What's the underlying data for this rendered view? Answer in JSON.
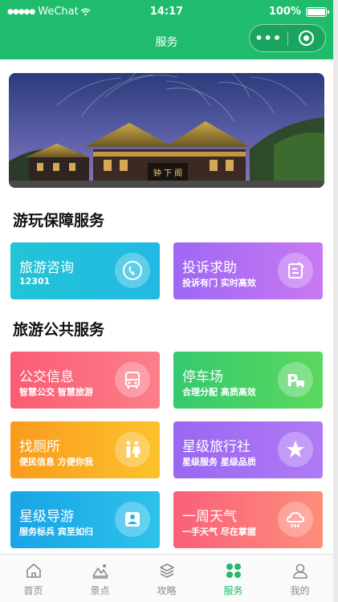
{
  "status_bar": {
    "carrier": "WeChat",
    "time": "14:17",
    "battery": "100%"
  },
  "nav": {
    "title": "服务",
    "more_icon": "more-dots-icon",
    "close_icon": "close-circle-icon"
  },
  "banner": {
    "sign_text": "钟 下 阁"
  },
  "sections": [
    {
      "title": "游玩保障服务",
      "cards": [
        {
          "title": "旅游咨询",
          "subtitle": "12301",
          "icon": "phone-icon",
          "colors": [
            "#22c4d6",
            "#22b9e3"
          ]
        },
        {
          "title": "投诉求助",
          "subtitle": "投诉有门 实时高效",
          "icon": "complaint-icon",
          "colors": [
            "#9e67f4",
            "#c879f2"
          ]
        }
      ]
    },
    {
      "title": "旅游公共服务",
      "cards": [
        {
          "title": "公交信息",
          "subtitle": "智慧公交 智慧旅游",
          "icon": "bus-icon",
          "colors": [
            "#fb5c74",
            "#fc7e8a"
          ]
        },
        {
          "title": "停车场",
          "subtitle": "合理分配 高质高效",
          "icon": "parking-icon",
          "colors": [
            "#35c96e",
            "#5bd85f"
          ]
        },
        {
          "title": "找厕所",
          "subtitle": "便民信息 方便你我",
          "icon": "restroom-icon",
          "colors": [
            "#fa9b1e",
            "#fcc22c"
          ]
        },
        {
          "title": "星级旅行社",
          "subtitle": "星级服务 星级品质",
          "icon": "star-icon",
          "colors": [
            "#9968f2",
            "#b07af5"
          ]
        },
        {
          "title": "星级导游",
          "subtitle": "服务标兵 宾至如归",
          "icon": "guide-icon",
          "colors": [
            "#18a4e6",
            "#2cc2ea"
          ]
        },
        {
          "title": "一周天气",
          "subtitle": "一手天气 尽在掌握",
          "icon": "weather-icon",
          "colors": [
            "#fa5f7a",
            "#fd8e7a"
          ]
        }
      ]
    }
  ],
  "tabbar": {
    "active": "服务",
    "active_color": "#1ebc6c",
    "items": [
      {
        "label": "首页",
        "icon": "home-icon"
      },
      {
        "label": "景点",
        "icon": "scenic-icon"
      },
      {
        "label": "攻略",
        "icon": "guide-layers-icon"
      },
      {
        "label": "服务",
        "icon": "service-grid-icon"
      },
      {
        "label": "我的",
        "icon": "profile-icon"
      }
    ]
  }
}
